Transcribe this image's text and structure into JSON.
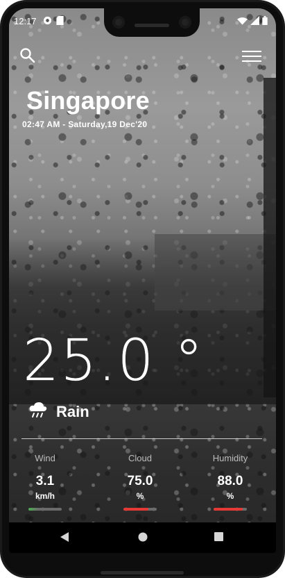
{
  "status_bar": {
    "time": "12:17",
    "left_icons": [
      "vpn-key-icon",
      "sd-card-icon"
    ],
    "right_icons": [
      "wifi-icon",
      "signal-icon",
      "battery-icon"
    ]
  },
  "header": {
    "search_icon": "search-icon",
    "menu_icon": "hamburger-menu-icon"
  },
  "location": {
    "city": "Singapore",
    "datetime": "02:47 AM - Saturday,19 Dec'20"
  },
  "weather": {
    "temperature": "25.0",
    "degree_symbol": "°",
    "condition": "Rain",
    "condition_icon": "rain-cloud-icon"
  },
  "stats": [
    {
      "label": "Wind",
      "value": "3.1",
      "unit": "km/h",
      "level": 0.0,
      "color": "#4caf50"
    },
    {
      "label": "Cloud",
      "value": "75.0",
      "unit": "%",
      "level": 0.75,
      "color": "#e53935"
    },
    {
      "label": "Humidity",
      "value": "88.0",
      "unit": "%",
      "level": 0.88,
      "color": "#e53935"
    }
  ],
  "nav_bar": {
    "back_icon": "back-triangle-icon",
    "home_icon": "home-circle-icon",
    "recents_icon": "recents-square-icon"
  },
  "colors": {
    "text": "#ffffff",
    "muted": "#bdbdbd",
    "bar_track": "#6b6b6b",
    "bar_red": "#e53935",
    "bar_green": "#4caf50"
  }
}
